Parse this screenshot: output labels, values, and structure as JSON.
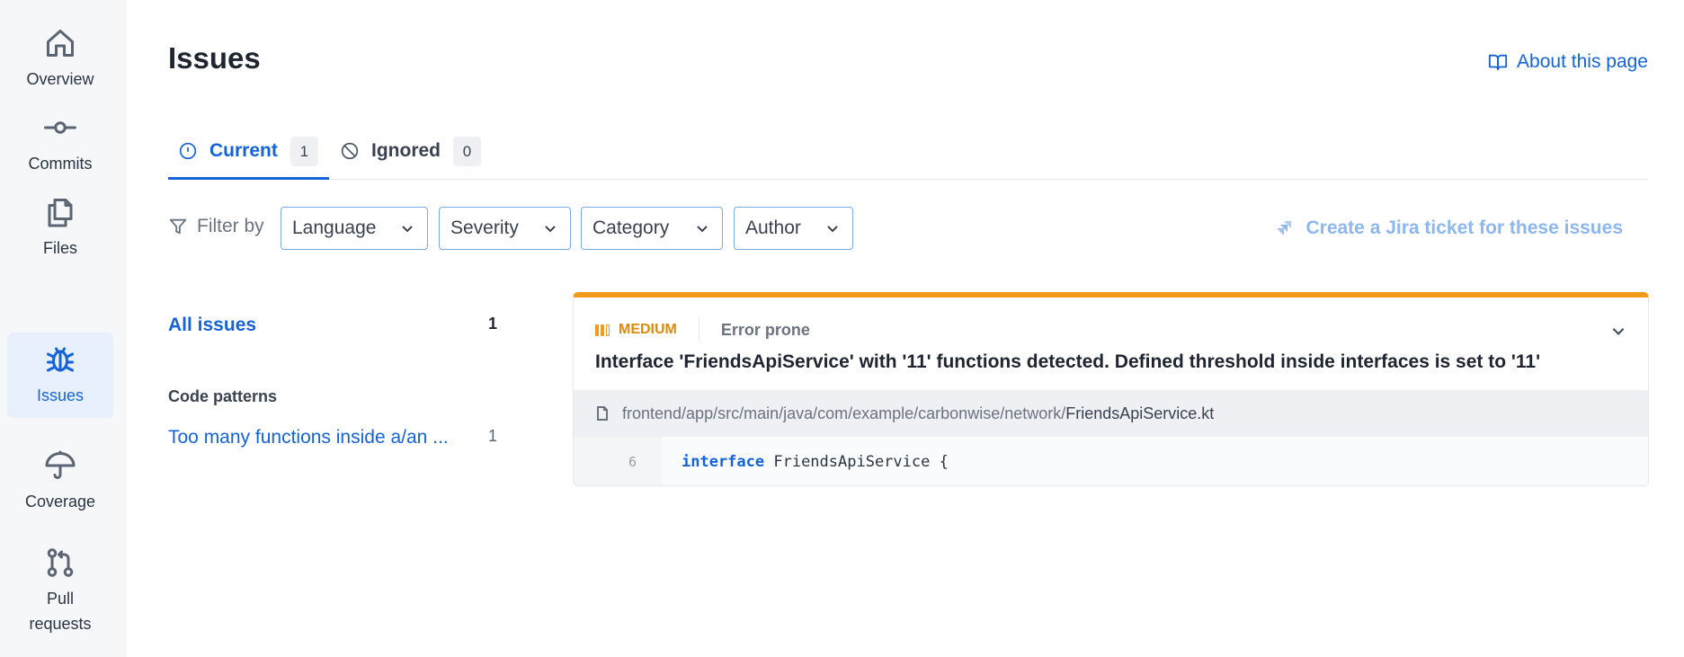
{
  "sidebar": {
    "items": [
      {
        "label": "Overview",
        "icon": "home-icon"
      },
      {
        "label": "Commits",
        "icon": "commit-icon"
      },
      {
        "label": "Files",
        "icon": "files-icon"
      },
      {
        "label": "Issues",
        "icon": "bug-icon",
        "active": true
      },
      {
        "label": "Coverage",
        "icon": "umbrella-icon"
      },
      {
        "label": "Pull requests",
        "icon": "pull-request-icon"
      }
    ]
  },
  "header": {
    "title": "Issues",
    "about_label": "About this page"
  },
  "tabs": [
    {
      "label": "Current",
      "count": "1",
      "icon": "info-circle-icon"
    },
    {
      "label": "Ignored",
      "count": "0",
      "icon": "ban-icon"
    }
  ],
  "filters": {
    "label": "Filter by",
    "dropdowns": [
      "Language",
      "Severity",
      "Category",
      "Author"
    ],
    "jira_label": "Create a Jira ticket for these issues"
  },
  "issue_list": {
    "all_label": "All issues",
    "all_count": "1",
    "section_heading": "Code patterns",
    "patterns": [
      {
        "label": "Too many functions inside a/an ...",
        "count": "1"
      }
    ]
  },
  "issue_card": {
    "severity": "MEDIUM",
    "category": "Error prone",
    "title": "Interface 'FriendsApiService' with '11' functions detected. Defined threshold inside interfaces is set to '11'",
    "file_path": "frontend/app/src/main/java/com/example/carbonwise/network/",
    "file_name": "FriendsApiService.kt",
    "line_number": "6",
    "code_keyword": "interface",
    "code_rest": " FriendsApiService {"
  },
  "colors": {
    "accent": "#1463d8",
    "severity_medium": "#f09b1a",
    "sidebar_bg": "#f6f7f9"
  }
}
